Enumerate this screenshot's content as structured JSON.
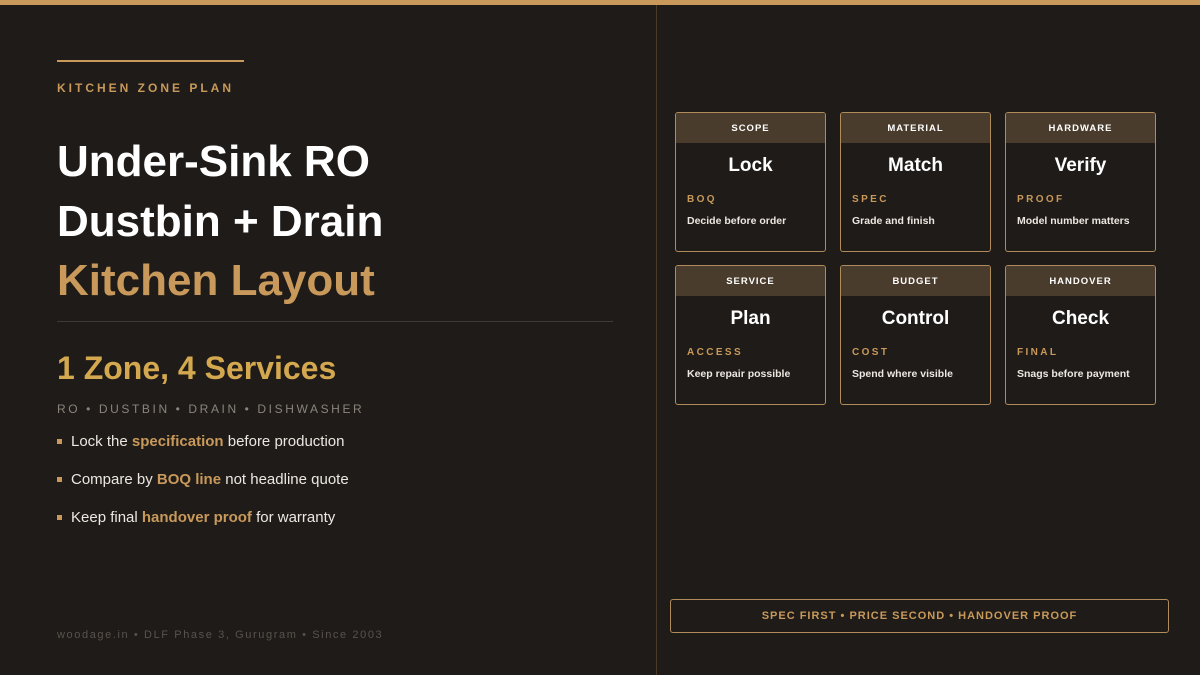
{
  "slide": {
    "eyebrow": "KITCHEN ZONE PLAN",
    "title_lines": [
      "Under-Sink RO",
      "Dustbin + Drain",
      "Kitchen Layout"
    ],
    "subtitle": "1 Zone, 4 Services",
    "tags": "RO • DUSTBIN • DRAIN • DISHWASHER",
    "bullets": [
      {
        "before": "Lock the ",
        "highlight": "specification",
        "after": " before production"
      },
      {
        "before": "Compare by ",
        "highlight": "BOQ line",
        "after": " not headline quote"
      },
      {
        "before": "Keep final ",
        "highlight": "handover proof",
        "after": " for warranty"
      }
    ],
    "footer": "woodage.in • DLF Phase 3, Gurugram • Since 2003"
  },
  "cards": [
    {
      "head": "SCOPE",
      "main": "Lock",
      "cat": "BOQ",
      "desc": "Decide before order"
    },
    {
      "head": "MATERIAL",
      "main": "Match",
      "cat": "SPEC",
      "desc": "Grade and finish"
    },
    {
      "head": "HARDWARE",
      "main": "Verify",
      "cat": "PROOF",
      "desc": "Model number matters"
    },
    {
      "head": "SERVICE",
      "main": "Plan",
      "cat": "ACCESS",
      "desc": "Keep repair possible"
    },
    {
      "head": "BUDGET",
      "main": "Control",
      "cat": "COST",
      "desc": "Spend where visible"
    },
    {
      "head": "HANDOVER",
      "main": "Check",
      "cat": "FINAL",
      "desc": "Snags before payment"
    }
  ],
  "banner": "SPEC FIRST • PRICE SECOND • HANDOVER PROOF",
  "colors": {
    "background": "#1e1b18",
    "accent": "#c8995a",
    "subtitle_gold": "#d4a84f",
    "card_header": "#4a3c2c"
  }
}
